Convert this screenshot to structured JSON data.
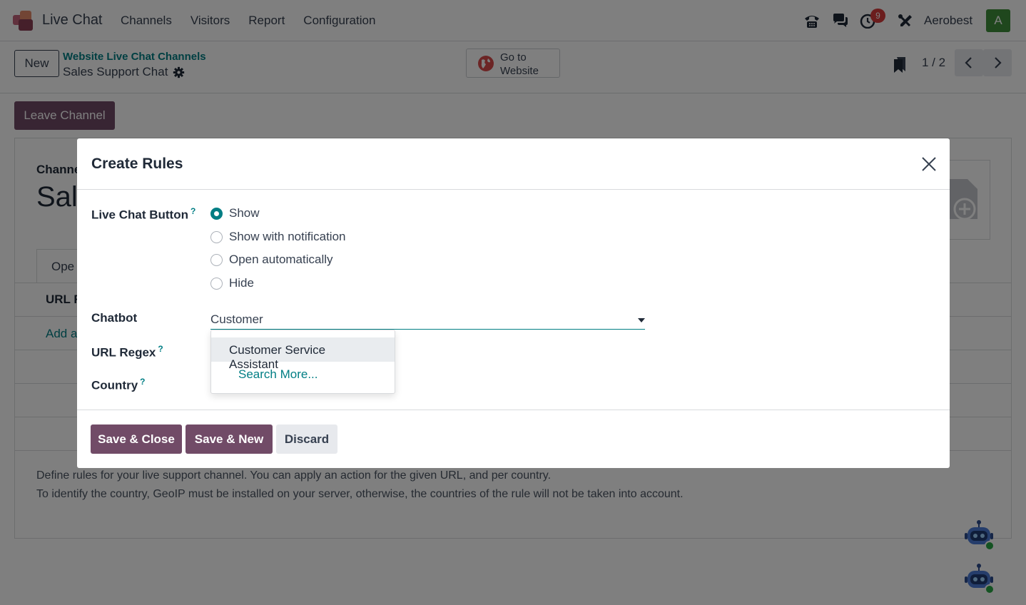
{
  "navbar": {
    "app_name": "Live Chat",
    "menu": [
      "Channels",
      "Visitors",
      "Report",
      "Configuration"
    ],
    "activity_count": "9",
    "company": "Aerobest",
    "avatar_letter": "A"
  },
  "control_panel": {
    "new_label": "New",
    "breadcrumb_parent": "Website Live Chat Channels",
    "breadcrumb_current": "Sales Support Chat",
    "website_button": "Go to Website",
    "pager": "1 / 2"
  },
  "form": {
    "leave_button": "Leave Channel",
    "channel_label": "Channe",
    "channel_name": "Sal",
    "tab_label": "Ope",
    "column_header": "URL R",
    "add_line": "Add a",
    "help_line_1": "Define rules for your live support channel. You can apply an action for the given URL, and per country.",
    "help_line_2": "To identify the country, GeoIP must be installed on your server, otherwise, the countries of the rule will not be taken into account."
  },
  "modal": {
    "title": "Create Rules",
    "live_chat_button_label": "Live Chat Button",
    "help_mark": "?",
    "options": [
      "Show",
      "Show with notification",
      "Open automatically",
      "Hide"
    ],
    "selected_option": "Show",
    "chatbot_label": "Chatbot",
    "chatbot_value": "Customer",
    "url_regex_label": "URL Regex",
    "country_label": "Country",
    "dropdown": {
      "item": "Customer Service Assistant",
      "search_more": "Search More..."
    },
    "footer": {
      "save_close": "Save & Close",
      "save_new": "Save & New",
      "discard": "Discard"
    }
  },
  "colors": {
    "primary": "#714b67",
    "accent": "#017e84",
    "badge": "#d63a3a",
    "avatar": "#3f8f3a"
  }
}
